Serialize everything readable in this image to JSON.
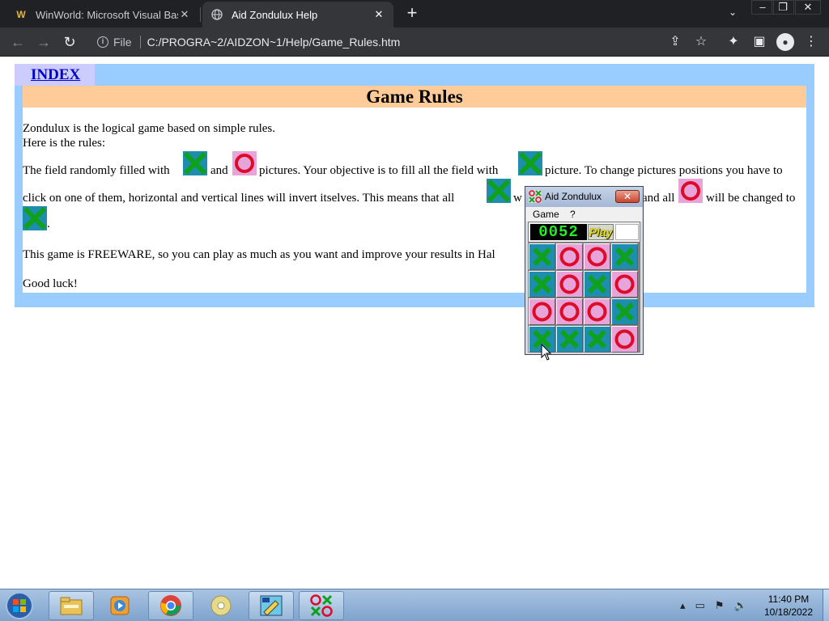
{
  "browser": {
    "tabs": [
      {
        "title": "WinWorld: Microsoft Visual Basic",
        "favicon": "W",
        "close": "✕"
      },
      {
        "title": "Aid Zondulux Help",
        "favicon": "globe",
        "close": "✕"
      }
    ],
    "new_tab": "+",
    "address": {
      "scheme_label": "File",
      "url": "C:/PROGRA~2/AIDZON~1/Help/Game_Rules.htm"
    }
  },
  "help_page": {
    "index_link": "INDEX",
    "title": "Game Rules",
    "lines": {
      "l1": "Zondulux is the logical game based on simple rules.",
      "l2": "Here is the rules:",
      "l3a": "The field randomly filled with",
      "l3b": "and",
      "l3c": "pictures. Your objective is to fill all the field with",
      "l3d": "picture. To change pictures positions you have to",
      "l4a": "click on one of them, horizontal and vertical lines will invert itselves. This means that all",
      "l4b": "w",
      "l4c": "and all",
      "l4d": "will be changed to",
      "l5": ".",
      "l6": "This game is FREEWARE, so you can play as much as you want and improve your results in Hal",
      "l7": "Good luck!"
    }
  },
  "game_window": {
    "title": "Aid Zondulux",
    "close": "✕",
    "menu": [
      "Game",
      "?"
    ],
    "counter": "0052",
    "play_label": "Play",
    "board": [
      [
        "X",
        "O",
        "O",
        "X"
      ],
      [
        "X",
        "O",
        "X",
        "O"
      ],
      [
        "O",
        "O",
        "O",
        "X"
      ],
      [
        "X",
        "X",
        "X",
        "O"
      ]
    ],
    "colors": {
      "x_bg": "#1f8db0",
      "x_mark": "#0fa01e",
      "o_bg": "#e6a4d8",
      "o_mark": "#dd0a2a"
    }
  },
  "taskbar": {
    "clock_time": "11:40 PM",
    "clock_date": "10/18/2022"
  }
}
